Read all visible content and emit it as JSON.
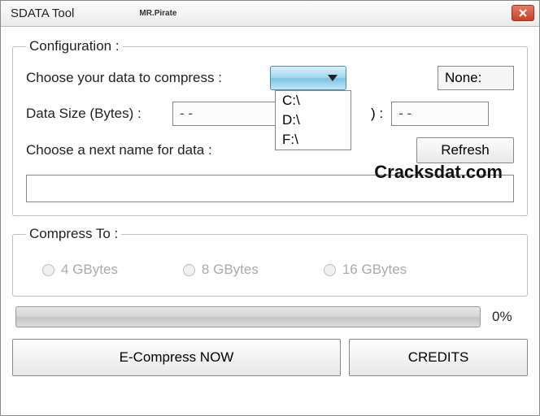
{
  "window": {
    "title": "SDATA Tool",
    "extra_label": "MR.Pirate"
  },
  "config": {
    "legend": "Configuration :",
    "choose_label": "Choose your data to compress :",
    "none_text": "None:",
    "drive_options": [
      "C:\\",
      "D:\\",
      "F:\\"
    ],
    "size_label": "Data Size (Bytes) :",
    "size_value": "- -",
    "paren_label": ") :",
    "paren_value": "- -",
    "name_label": "Choose a next name for data :",
    "refresh_label": "Refresh",
    "watermark": "Cracksdat.com"
  },
  "compress": {
    "legend": "Compress To :",
    "options": [
      "4 GBytes",
      "8 GBytes",
      "16 GBytes"
    ]
  },
  "progress": {
    "percent": "0%"
  },
  "buttons": {
    "compress_now": "E-Compress NOW",
    "credits": "CREDITS"
  }
}
